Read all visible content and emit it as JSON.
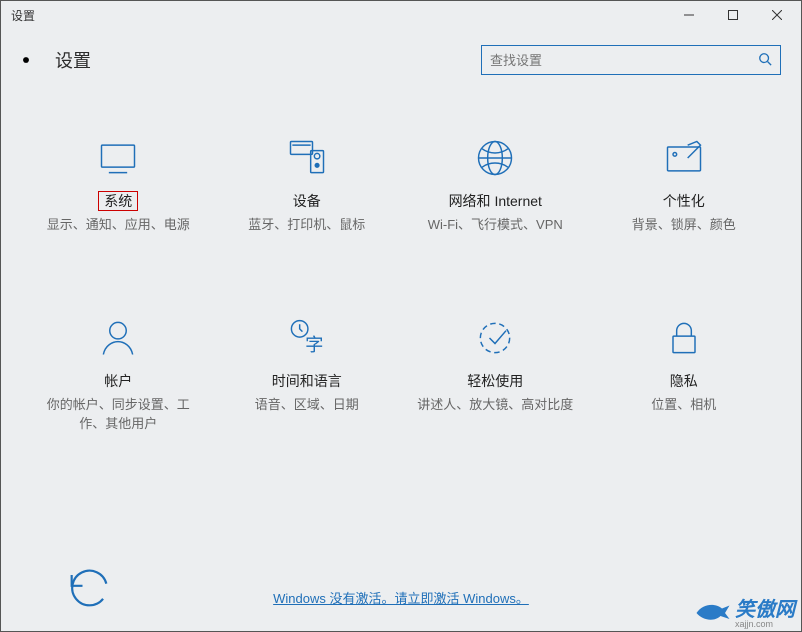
{
  "window": {
    "title": "设置"
  },
  "header": {
    "title": "设置",
    "search_placeholder": "查找设置"
  },
  "tiles": [
    {
      "title": "系统",
      "desc": "显示、通知、应用、电源"
    },
    {
      "title": "设备",
      "desc": "蓝牙、打印机、鼠标"
    },
    {
      "title": "网络和 Internet",
      "desc": "Wi-Fi、飞行模式、VPN"
    },
    {
      "title": "个性化",
      "desc": "背景、锁屏、颜色"
    },
    {
      "title": "帐户",
      "desc": "你的帐户、同步设置、工作、其他用户"
    },
    {
      "title": "时间和语言",
      "desc": "语音、区域、日期"
    },
    {
      "title": "轻松使用",
      "desc": "讲述人、放大镜、高对比度"
    },
    {
      "title": "隐私",
      "desc": "位置、相机"
    }
  ],
  "activation_text": "Windows 没有激活。请立即激活 Windows。",
  "watermark": {
    "brand": "笑傲网",
    "url": "xajjn.com"
  },
  "colors": {
    "accent": "#1f6fb8"
  }
}
